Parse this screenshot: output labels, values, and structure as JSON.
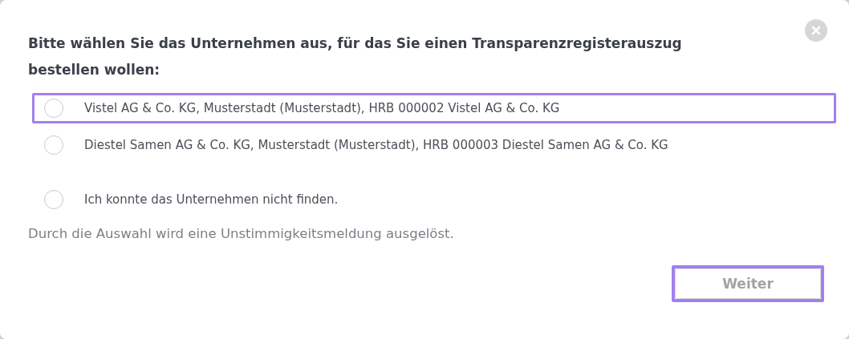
{
  "dialog": {
    "heading": "Bitte wählen Sie das Unternehmen aus, für das Sie einen Transparenzregisterauszug bestellen wollen:",
    "options": [
      {
        "label": "Vistel AG & Co. KG, Musterstadt (Musterstadt), HRB 000002 Vistel AG & Co. KG",
        "selected": false,
        "highlighted": true,
        "kind": "company"
      },
      {
        "label": "Diestel Samen AG & Co. KG, Musterstadt (Musterstadt), HRB 000003 Diestel Samen AG & Co. KG",
        "selected": false,
        "highlighted": false,
        "kind": "company"
      },
      {
        "label": "Ich konnte das Unternehmen nicht finden.",
        "selected": false,
        "highlighted": false,
        "kind": "not-found"
      }
    ],
    "note": "Durch die Auswahl wird eine Unstimmigkeitsmeldung ausgelöst.",
    "button": {
      "label": "Weiter",
      "disabled": true,
      "highlighted": true
    }
  }
}
